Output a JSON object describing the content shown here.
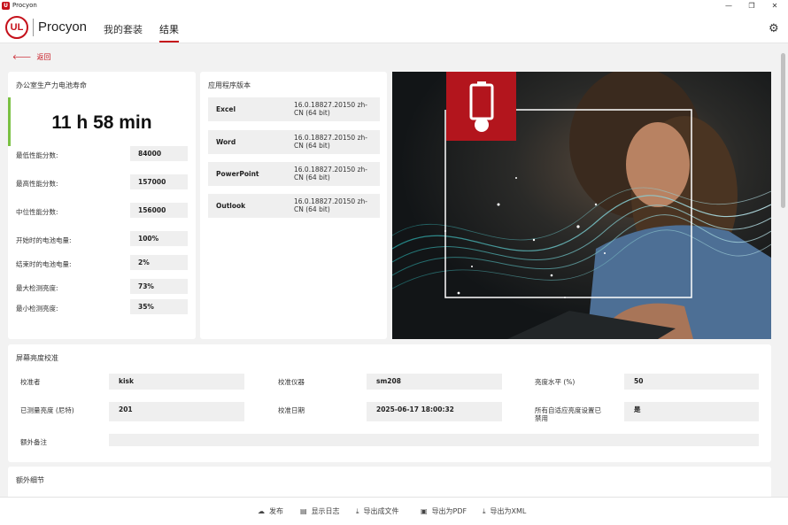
{
  "window": {
    "title": "Procyon",
    "minimize": "—",
    "restore": "❐",
    "close": "✕"
  },
  "header": {
    "logo": "UL",
    "brand": "Procyon",
    "tabs": [
      {
        "label": "我的套装"
      },
      {
        "label": "结果"
      }
    ],
    "active_tab": "结果"
  },
  "back": {
    "label": "返回"
  },
  "battery": {
    "title": "办公室生产力电池寿命",
    "value": "11 h 58 min",
    "stats": [
      {
        "label": "最低性能分数:",
        "value": "84000"
      },
      {
        "label": "最高性能分数:",
        "value": "157000"
      },
      {
        "label": "中位性能分数:",
        "value": "156000"
      },
      {
        "label": "开始时的电池电量:",
        "value": "100%"
      },
      {
        "label": "结束时的电池电量:",
        "value": "2%"
      },
      {
        "label": "最大检测亮度:",
        "value": "73%"
      },
      {
        "label": "最小检测亮度:",
        "value": "35%"
      }
    ]
  },
  "apps": {
    "title": "应用程序版本",
    "rows": [
      {
        "name": "Excel",
        "version_line1": "16.0.18827.20150 zh-",
        "version_line2": "CN (64 bit)"
      },
      {
        "name": "Word",
        "version_line1": "16.0.18827.20150 zh-",
        "version_line2": "CN (64 bit)"
      },
      {
        "name": "PowerPoint",
        "version_line1": "16.0.18827.20150 zh-",
        "version_line2": "CN (64 bit)"
      },
      {
        "name": "Outlook",
        "version_line1": "16.0.18827.20150 zh-",
        "version_line2": "CN (64 bit)"
      }
    ]
  },
  "calibration": {
    "title": "屏幕亮度校准",
    "calibrator_label": "校准者",
    "calibrator_value": "kisk",
    "device_label": "校准仪器",
    "device_value": "sm208",
    "brightness_label": "亮度水平 (%)",
    "brightness_value": "50",
    "measured_label": "已测量亮度 (尼特)",
    "measured_value": "201",
    "date_label": "校准日期",
    "date_value": "2025-06-17 18:00:32",
    "adaptive_label_line1": "所有自适应亮度设置已",
    "adaptive_label_line2": "禁用",
    "adaptive_value": "是",
    "notes_label": "额外备注",
    "notes_value": ""
  },
  "extra": {
    "title": "额外细节"
  },
  "footer": {
    "buttons": [
      {
        "label": "发布"
      },
      {
        "label": "显示日志"
      },
      {
        "label": "导出成文件"
      },
      {
        "label": "导出为PDF"
      },
      {
        "label": "导出为XML"
      }
    ]
  },
  "colors": {
    "accent": "#c5111b",
    "good": "#7ac143"
  }
}
